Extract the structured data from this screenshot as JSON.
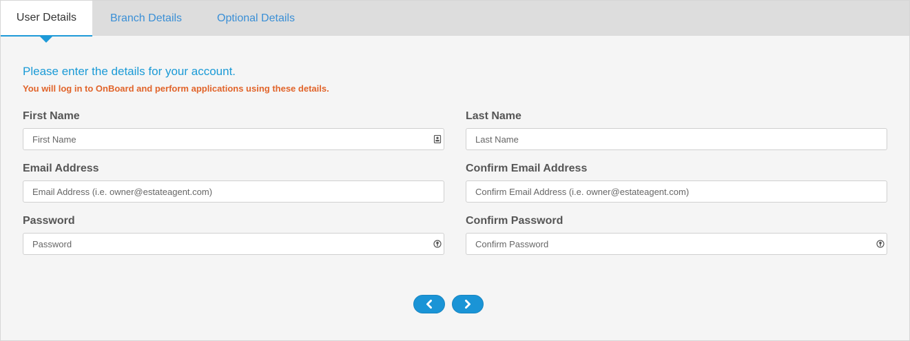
{
  "tabs": [
    {
      "label": "User Details",
      "active": true
    },
    {
      "label": "Branch Details",
      "active": false
    },
    {
      "label": "Optional Details",
      "active": false
    }
  ],
  "intro": {
    "title": "Please enter the details for your account.",
    "subtitle": "You will log in to OnBoard and perform applications using these details."
  },
  "fields": {
    "first_name": {
      "label": "First Name",
      "placeholder": "First Name",
      "value": "",
      "icon": "contact-card-icon"
    },
    "last_name": {
      "label": "Last Name",
      "placeholder": "Last Name",
      "value": ""
    },
    "email": {
      "label": "Email Address",
      "placeholder": "Email Address (i.e. owner@estateagent.com)",
      "value": ""
    },
    "confirm_email": {
      "label": "Confirm Email Address",
      "placeholder": "Confirm Email Address (i.e. owner@estateagent.com)",
      "value": ""
    },
    "password": {
      "label": "Password",
      "placeholder": "Password",
      "value": "",
      "icon": "password-key-icon"
    },
    "confirm_password": {
      "label": "Confirm Password",
      "placeholder": "Confirm Password",
      "value": "",
      "icon": "password-key-icon"
    }
  },
  "nav": {
    "prev_icon": "chevron-left-icon",
    "next_icon": "chevron-right-icon"
  },
  "colors": {
    "accent": "#1a94d6",
    "tab_link": "#3a8fd6",
    "warning_text": "#e1642a",
    "label_text": "#555555"
  }
}
